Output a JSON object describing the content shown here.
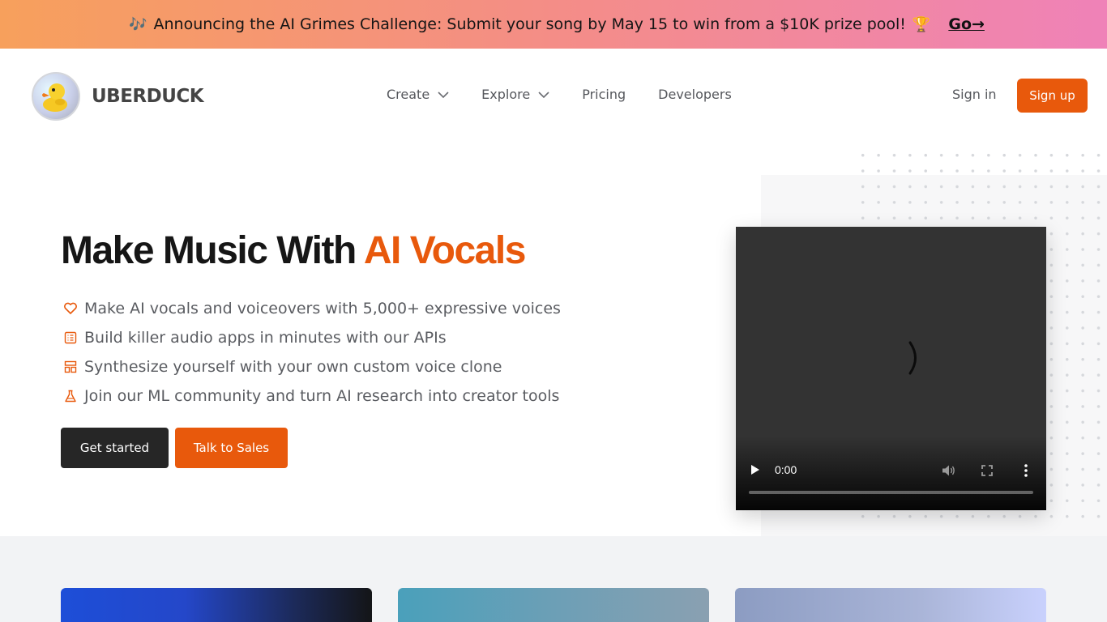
{
  "banner": {
    "leading_emoji": "🎶",
    "text": "Announcing the AI Grimes Challenge: Submit your song by May 15 to win from a $10K prize pool!",
    "trailing_emoji": "🏆",
    "link_label": "Go→"
  },
  "header": {
    "brand": "UBERDUCK",
    "nav": {
      "create": "Create",
      "explore": "Explore",
      "pricing": "Pricing",
      "developers": "Developers"
    },
    "sign_in": "Sign in",
    "sign_up": "Sign up"
  },
  "hero": {
    "headline_main": "Make Music With",
    "headline_accent": "AI Vocals",
    "features": [
      {
        "icon": "heart-icon",
        "text": "Make AI vocals and voiceovers with 5,000+ expressive voices"
      },
      {
        "icon": "list-icon",
        "text": "Build killer audio apps in minutes with our APIs"
      },
      {
        "icon": "layout-icon",
        "text": "Synthesize yourself with your own custom voice clone"
      },
      {
        "icon": "flask-icon",
        "text": "Join our ML community and turn AI research into creator tools"
      }
    ],
    "primary_cta": "Get started",
    "secondary_cta": "Talk to Sales"
  },
  "video": {
    "current_time": "0:00",
    "progress": 0
  },
  "colors": {
    "accent": "#e8590c",
    "dark": "#262626",
    "banner_gradient_start": "#f7a05c",
    "banner_gradient_end": "#ef82b8"
  }
}
